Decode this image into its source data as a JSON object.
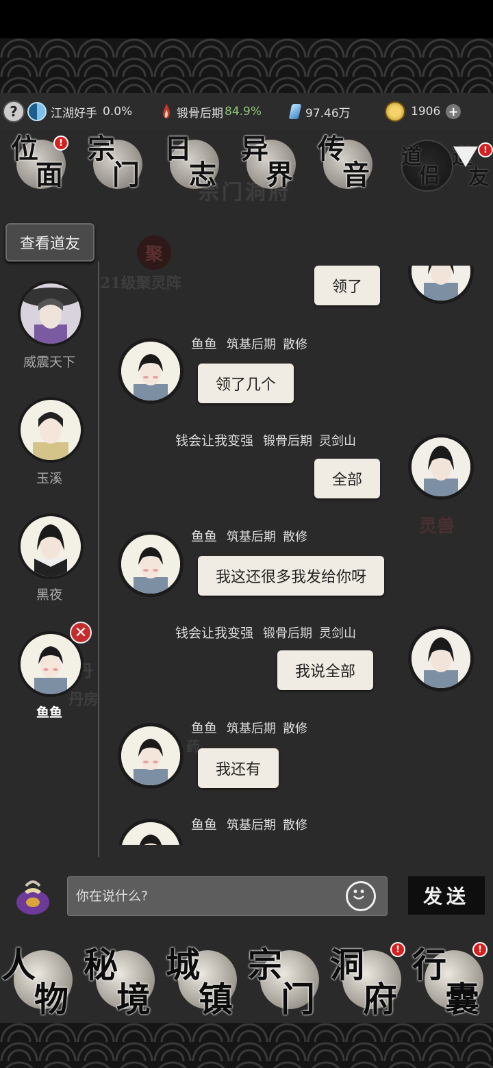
{
  "resources": {
    "help_label": "?",
    "rank_title": "江湖好手",
    "rank_pct": "0.0%",
    "realm": "锻骨后期",
    "realm_pct": "84.9%",
    "spirit_stones": "97.46万",
    "coins": "1906",
    "add_label": "+"
  },
  "top_nav": [
    {
      "c1": "位",
      "c2": "面",
      "badge": "!"
    },
    {
      "c1": "宗",
      "c2": "门"
    },
    {
      "c1": "日",
      "c2": "志"
    },
    {
      "c1": "异",
      "c2": "界"
    },
    {
      "c1": "传",
      "c2": "音"
    },
    {
      "c1": "道",
      "c2": "侣"
    },
    {
      "c1": "道",
      "c2": "友",
      "badge": "!"
    }
  ],
  "background_text": {
    "zong_men": "宗门洞府",
    "ju": "聚",
    "ju_ling": "21级聚灵阵",
    "ling_shou": "灵兽",
    "dan": "丹",
    "dan_fang": "丹房",
    "yao": "药"
  },
  "sidebar": {
    "view_friends": "查看道友",
    "friends": [
      {
        "name": "威震天下"
      },
      {
        "name": "玉溪"
      },
      {
        "name": "黑夜"
      },
      {
        "name": "鱼鱼",
        "active": true,
        "delete": "✕"
      }
    ]
  },
  "chat": {
    "messages": [
      {
        "side": "right",
        "text": "领了"
      },
      {
        "side": "left",
        "name": "鱼鱼",
        "rank": "筑基后期",
        "sect": "散修",
        "text": "领了几个"
      },
      {
        "side": "right",
        "name": "钱会让我变强",
        "rank": "锻骨后期",
        "sect": "灵剑山",
        "text": "全部"
      },
      {
        "side": "left",
        "name": "鱼鱼",
        "rank": "筑基后期",
        "sect": "散修",
        "text": "我这还很多我发给你呀"
      },
      {
        "side": "right",
        "name": "钱会让我变强",
        "rank": "锻骨后期",
        "sect": "灵剑山",
        "text": "我说全部"
      },
      {
        "side": "left",
        "name": "鱼鱼",
        "rank": "筑基后期",
        "sect": "散修",
        "text": "我还有"
      },
      {
        "side": "left",
        "name": "鱼鱼",
        "rank": "筑基后期",
        "sect": "散修",
        "text": ""
      }
    ]
  },
  "input": {
    "placeholder": "你在说什么?",
    "send_label": "发送"
  },
  "bottom_nav": [
    {
      "c1": "人",
      "c2": "物"
    },
    {
      "c1": "秘",
      "c2": "境"
    },
    {
      "c1": "城",
      "c2": "镇"
    },
    {
      "c1": "宗",
      "c2": "门"
    },
    {
      "c1": "洞",
      "c2": "府",
      "badge": "!"
    },
    {
      "c1": "行",
      "c2": "囊",
      "badge": "!"
    }
  ],
  "colors": {
    "bubble": "#f1ece3",
    "progress_green": "#8fc47a",
    "badge_red": "#d62020"
  }
}
